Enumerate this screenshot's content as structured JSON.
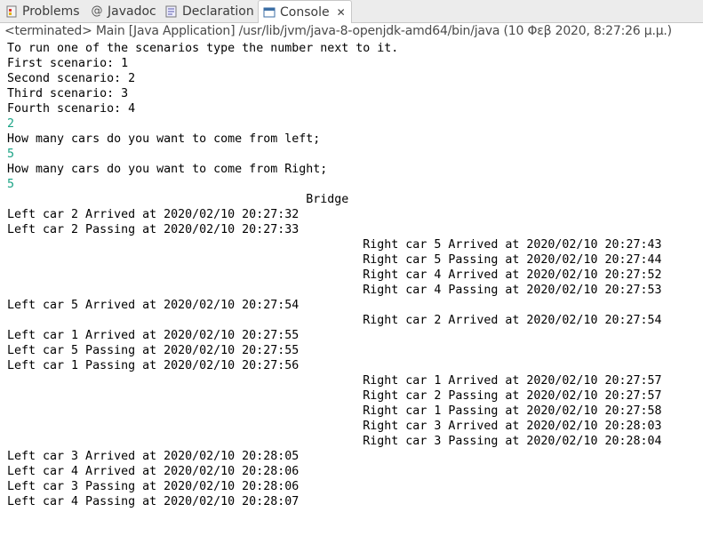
{
  "tabs": [
    {
      "label": "Problems",
      "icon": "problems-icon"
    },
    {
      "label": "Javadoc",
      "icon": "javadoc-icon"
    },
    {
      "label": "Declaration",
      "icon": "declaration-icon"
    },
    {
      "label": "Console",
      "icon": "console-icon",
      "active": true
    }
  ],
  "status_line": "<terminated> Main [Java Application] /usr/lib/jvm/java-8-openjdk-amd64/bin/java (10 Φεβ 2020, 8:27:26 μ.μ.)",
  "console_lines": [
    {
      "text": "To run one of the scenarios type the number next to it.",
      "kind": "out"
    },
    {
      "text": "First scenario: 1",
      "kind": "out"
    },
    {
      "text": "Second scenario: 2",
      "kind": "out"
    },
    {
      "text": "Third scenario: 3",
      "kind": "out"
    },
    {
      "text": "Fourth scenario: 4",
      "kind": "out"
    },
    {
      "text": "2",
      "kind": "in"
    },
    {
      "text": "How many cars do you want to come from left;",
      "kind": "out"
    },
    {
      "text": "5",
      "kind": "in"
    },
    {
      "text": "How many cars do you want to come from Right;",
      "kind": "out"
    },
    {
      "text": "5",
      "kind": "in"
    },
    {
      "text": "                                          Bridge",
      "kind": "out"
    },
    {
      "text": "Left car 2 Arrived at 2020/02/10 20:27:32",
      "kind": "out"
    },
    {
      "text": "Left car 2 Passing at 2020/02/10 20:27:33",
      "kind": "out"
    },
    {
      "text": "                                                  Right car 5 Arrived at 2020/02/10 20:27:43",
      "kind": "out"
    },
    {
      "text": "                                                  Right car 5 Passing at 2020/02/10 20:27:44",
      "kind": "out"
    },
    {
      "text": "                                                  Right car 4 Arrived at 2020/02/10 20:27:52",
      "kind": "out"
    },
    {
      "text": "                                                  Right car 4 Passing at 2020/02/10 20:27:53",
      "kind": "out"
    },
    {
      "text": "Left car 5 Arrived at 2020/02/10 20:27:54",
      "kind": "out"
    },
    {
      "text": "                                                  Right car 2 Arrived at 2020/02/10 20:27:54",
      "kind": "out"
    },
    {
      "text": "Left car 1 Arrived at 2020/02/10 20:27:55",
      "kind": "out"
    },
    {
      "text": "Left car 5 Passing at 2020/02/10 20:27:55",
      "kind": "out"
    },
    {
      "text": "Left car 1 Passing at 2020/02/10 20:27:56",
      "kind": "out"
    },
    {
      "text": "                                                  Right car 1 Arrived at 2020/02/10 20:27:57",
      "kind": "out"
    },
    {
      "text": "                                                  Right car 2 Passing at 2020/02/10 20:27:57",
      "kind": "out"
    },
    {
      "text": "                                                  Right car 1 Passing at 2020/02/10 20:27:58",
      "kind": "out"
    },
    {
      "text": "                                                  Right car 3 Arrived at 2020/02/10 20:28:03",
      "kind": "out"
    },
    {
      "text": "                                                  Right car 3 Passing at 2020/02/10 20:28:04",
      "kind": "out"
    },
    {
      "text": "Left car 3 Arrived at 2020/02/10 20:28:05",
      "kind": "out"
    },
    {
      "text": "Left car 4 Arrived at 2020/02/10 20:28:06",
      "kind": "out"
    },
    {
      "text": "Left car 3 Passing at 2020/02/10 20:28:06",
      "kind": "out"
    },
    {
      "text": "Left car 4 Passing at 2020/02/10 20:28:07",
      "kind": "out"
    }
  ],
  "colors": {
    "input_text": "#1aa385",
    "output_text": "#000000",
    "tabbar_bg": "#ececec"
  }
}
